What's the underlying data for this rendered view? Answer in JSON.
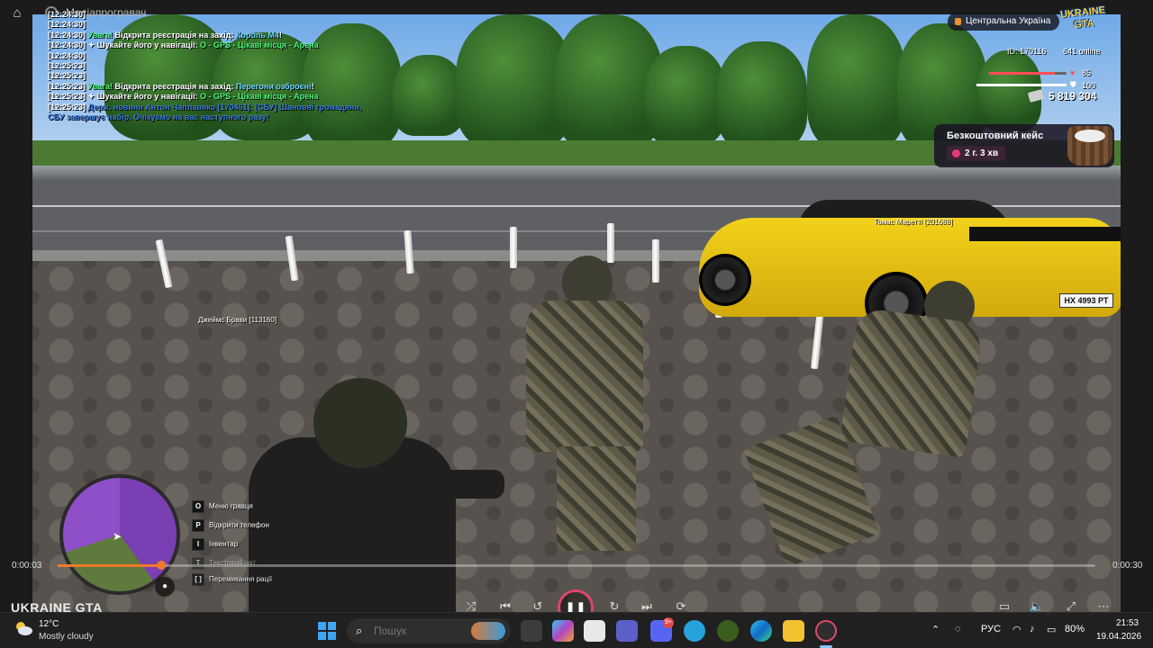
{
  "window": {
    "title": "Медіапрогравач"
  },
  "chat": {
    "lines": [
      {
        "time": "[12:24:30]",
        "parts": []
      },
      {
        "time": "[12:24:30]",
        "parts": []
      },
      {
        "time": "[12:24:30]",
        "parts": [
          {
            "cls": "c-warn",
            "text": "Увага!"
          },
          {
            "cls": "",
            "text": " Відкрита реєстрація на захід: "
          },
          {
            "cls": "c-link",
            "text": "Король М4"
          },
          {
            "cls": "",
            "text": "!"
          }
        ]
      },
      {
        "time": "[12:24:30]",
        "parts": [
          {
            "cls": "",
            "text": " ✦  Шукайте його у навігації: "
          },
          {
            "cls": "c-gps",
            "text": "О - GPS - Цікаві місця - Арена"
          }
        ]
      },
      {
        "time": "[12:24:30]",
        "parts": []
      },
      {
        "time": "[12:25:23]",
        "parts": []
      },
      {
        "time": "[12:25:23]",
        "parts": []
      },
      {
        "time": "[12:25:23]",
        "parts": [
          {
            "cls": "c-warn",
            "text": "Увага!"
          },
          {
            "cls": "",
            "text": " Відкрита реєстрація на захід: "
          },
          {
            "cls": "c-link",
            "text": "Перегони озброєні"
          },
          {
            "cls": "",
            "text": "!"
          }
        ]
      },
      {
        "time": "[12:25:23]",
        "parts": [
          {
            "cls": "",
            "text": " ✦  Шукайте його у навігації: "
          },
          {
            "cls": "c-gps",
            "text": "О - GPS - Цікаві місця - Арена"
          }
        ]
      },
      {
        "time": "[12:25:23]",
        "parts": [
          {
            "cls": "c-blue",
            "text": " Держ. новини Антон Чаплавяко [170461]: [СБУ] Шановні громадяни,"
          }
        ]
      },
      {
        "time": "",
        "parts": [
          {
            "cls": "c-blue",
            "text": "СБУ завершує набір. Очікуємо на вас наступного разу!"
          }
        ]
      }
    ]
  },
  "hud": {
    "region": "Центральна Україна",
    "logo": "UKRAINE GTA",
    "player_id": "ID: 170116",
    "online": "641 online",
    "health": 85,
    "armor": 100,
    "health_label": "85",
    "armor_label": "100",
    "money": "5 819 304",
    "colors": {
      "health": "#ff4b57",
      "armor": "#ffffff",
      "accent": "#f07a2a"
    },
    "icons": {
      "health": "heart-icon",
      "armor": "shield-icon",
      "money": "cash-icon"
    }
  },
  "free_case": {
    "title": "Безкоштовний кейс",
    "timer": "2 г. 3 хв"
  },
  "nametags": {
    "car_owner": "Томас Маретті [201688]",
    "player": "Джеймс Брави [113160]"
  },
  "vehicle": {
    "plate": "НХ 4993 РТ"
  },
  "keybinds": [
    {
      "key": "O",
      "label": "Меню гравця"
    },
    {
      "key": "P",
      "label": "Відкрити телефон"
    },
    {
      "key": "I",
      "label": "Інвентар"
    },
    {
      "key": "T",
      "label": "Текстовий чат"
    },
    {
      "key": "[  ]",
      "label": "Перемикання рації"
    }
  ],
  "video": {
    "current_time": "0:00:03",
    "duration": "0:00:30",
    "progress_fraction": 0.1,
    "watermark": "UKRAINE GTA"
  },
  "taskbar": {
    "weather_temp": "12°C",
    "weather_desc": "Mostly cloudy",
    "search_placeholder": "Пошук",
    "discord_badge": "9+",
    "language": "РУС",
    "battery": "80%",
    "time": "21:53",
    "date": "19.04.2026"
  }
}
